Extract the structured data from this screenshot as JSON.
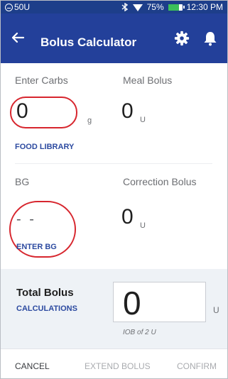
{
  "status_bar": {
    "pump_reading": "50U",
    "battery_percent": "75%",
    "time": "12:30 PM",
    "bluetooth_icon": "bluetooth-icon",
    "wifi_icon": "wifi-icon",
    "battery_icon": "battery-icon",
    "battery_level": 0.75
  },
  "header": {
    "title": "Bolus Calculator",
    "back_icon": "arrow-left-icon",
    "settings_icon": "gear-icon",
    "notifications_icon": "bell-icon"
  },
  "carbs": {
    "label": "Enter Carbs",
    "value": "0",
    "unit": "g",
    "link": "FOOD LIBRARY"
  },
  "meal_bolus": {
    "label": "Meal Bolus",
    "value": "0",
    "unit": "U"
  },
  "bg": {
    "label": "BG",
    "value": "- -",
    "link": "ENTER BG"
  },
  "correction_bolus": {
    "label": "Correction Bolus",
    "value": "0",
    "unit": "U"
  },
  "total_bolus": {
    "label": "Total Bolus",
    "link": "CALCULATIONS",
    "value": "0",
    "unit": "U",
    "iob": "IOB of 2 U"
  },
  "footer": {
    "cancel": "CANCEL",
    "extend": "EXTEND BOLUS",
    "confirm": "CONFIRM"
  },
  "colors": {
    "header_bg": "#23409a",
    "status_bg": "#1d3e8a",
    "link": "#2c4aa0",
    "highlight": "#d7262e",
    "total_bg": "#eef2f6"
  }
}
